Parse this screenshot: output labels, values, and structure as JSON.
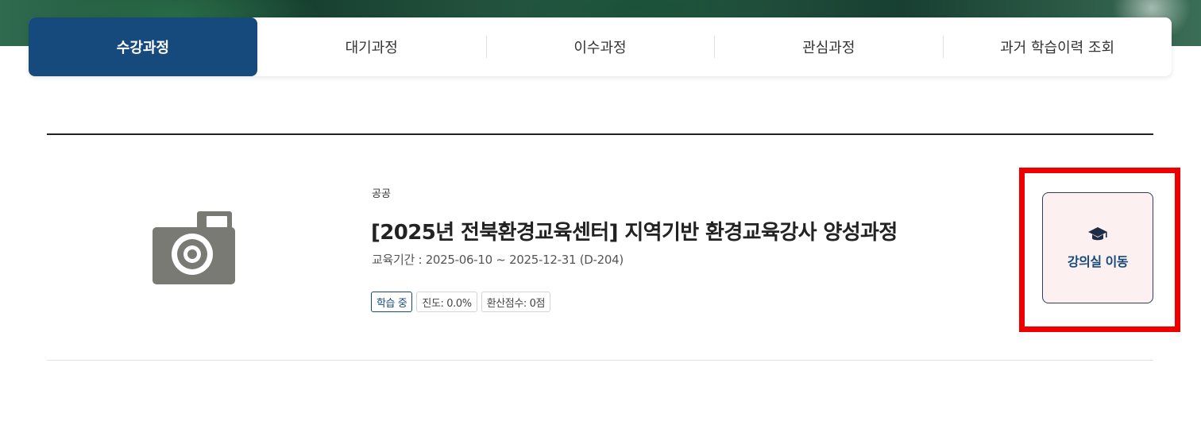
{
  "tabs": [
    {
      "label": "수강과정",
      "active": true
    },
    {
      "label": "대기과정",
      "active": false
    },
    {
      "label": "이수과정",
      "active": false
    },
    {
      "label": "관심과정",
      "active": false
    },
    {
      "label": "과거 학습이력 조회",
      "active": false
    }
  ],
  "course": {
    "category": "공공",
    "title": "[2025년 전북환경교육센터] 지역기반 환경교육강사 양성과정",
    "period": "교육기간 : 2025-06-10 ~ 2025-12-31 (D-204)",
    "badges": {
      "status": "학습 중",
      "progress": "진도: 0.0%",
      "score": "환산점수: 0점"
    },
    "thumbnail_icon": "camera-icon",
    "action": {
      "icon": "graduation-cap-icon",
      "label": "강의실 이동"
    }
  },
  "colors": {
    "primary": "#174a7c",
    "highlight": "#ee0000",
    "button_bg": "#fdf0f0"
  }
}
